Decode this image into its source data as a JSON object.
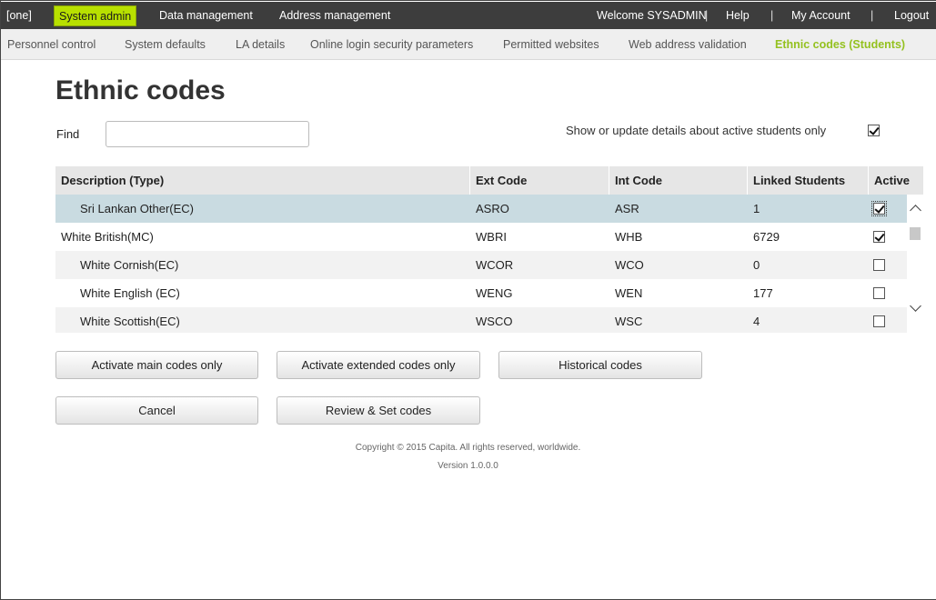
{
  "topbar": {
    "one": "[one]",
    "system_admin": "System admin",
    "data_management": "Data management",
    "address_management": "Address management",
    "welcome": "Welcome SYSADMIN",
    "separator": "|",
    "help": "Help",
    "my_account": "My Account",
    "logout": "Logout"
  },
  "subnav": [
    {
      "label": "Personnel control"
    },
    {
      "label": "System defaults"
    },
    {
      "label": "LA details"
    },
    {
      "label": "Online login security parameters"
    },
    {
      "label": "Permitted websites"
    },
    {
      "label": "Web address validation"
    },
    {
      "label": "Ethnic codes (Students)",
      "active": true
    }
  ],
  "page": {
    "title": "Ethnic codes",
    "find_label": "Find",
    "find_value": "",
    "active_only_label": "Show or update details about active students only",
    "active_only_checked": true
  },
  "table": {
    "headers": [
      "Description (Type)",
      "Ext Code",
      "Int Code",
      "Linked Students",
      "Active"
    ],
    "rows": [
      {
        "description": "Sri Lankan Other(EC)",
        "ext": "ASRO",
        "int": "ASR",
        "linked": "1",
        "active": true
      },
      {
        "description": "White British(MC)",
        "ext": "WBRI",
        "int": "WHB",
        "linked": "6729",
        "active": true
      },
      {
        "description": "White Cornish(EC)",
        "ext": "WCOR",
        "int": "WCO",
        "linked": "0",
        "active": false
      },
      {
        "description": "White English (EC)",
        "ext": "WENG",
        "int": "WEN",
        "linked": "177",
        "active": false
      },
      {
        "description": "White Scottish(EC)",
        "ext": "WSCO",
        "int": "WSC",
        "linked": "4",
        "active": false
      }
    ]
  },
  "buttons": {
    "activate_main": "Activate main codes only",
    "activate_extended": "Activate extended codes only",
    "historical": "Historical codes",
    "cancel": "Cancel",
    "review_set": "Review & Set codes"
  },
  "footer": {
    "copyright": "Copyright © 2015 Capita. All rights reserved, worldwide.",
    "version": "Version 1.0.0.0"
  },
  "colors": {
    "topbar_bg": "#3d3d3d",
    "accent_green": "#b8e000",
    "active_tab_text": "#94c11f",
    "selected_row": "#c9dbe1"
  }
}
